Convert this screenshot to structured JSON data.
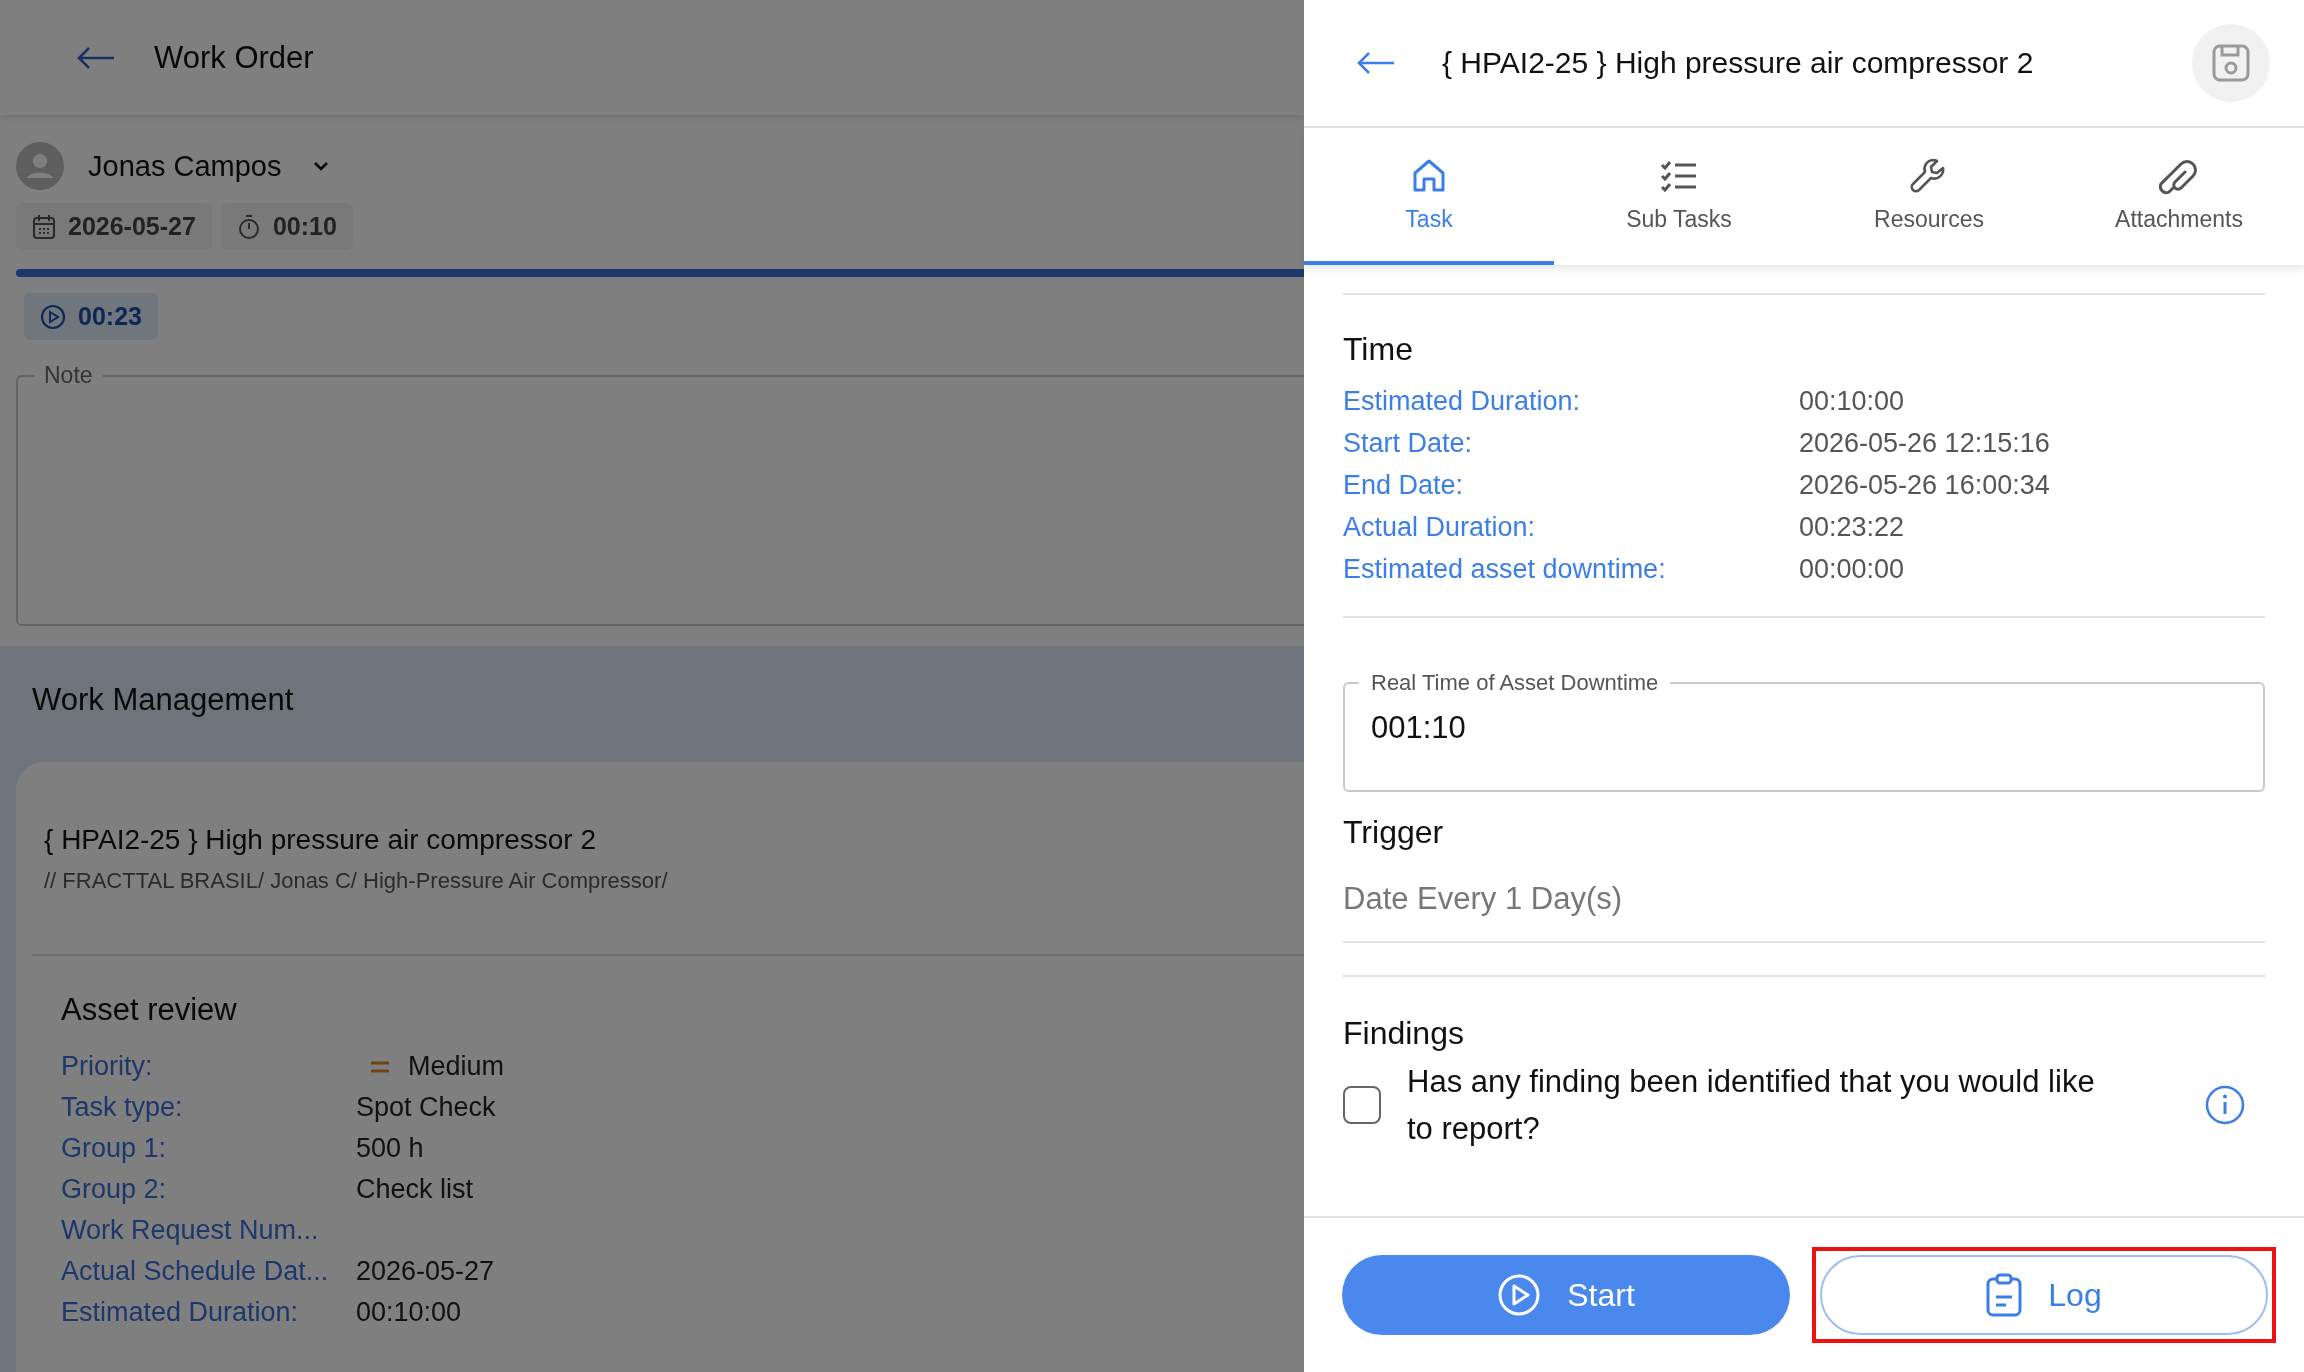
{
  "work_order": {
    "title": "Work Order",
    "assignee": "Jonas Campos",
    "date": "2026-05-27",
    "duration": "00:10",
    "progress": {
      "level": 1
    },
    "timer": "00:23",
    "note": {
      "label": "Note"
    }
  },
  "work_management": {
    "title": "Work Management",
    "asset_title": "{ HPAI2-25 } High pressure air compressor 2",
    "asset_path": "// FRACTTAL BRASIL/ Jonas C/ High-Pressure Air Compressor/",
    "section": "Asset review",
    "fields": [
      {
        "label": "Priority:",
        "value": "Medium",
        "kind": "priority"
      },
      {
        "label": "Task type:",
        "value": "Spot Check",
        "kind": "text"
      },
      {
        "label": "Group 1:",
        "value": "500 h",
        "kind": "text"
      },
      {
        "label": "Group 2:",
        "value": "Check list",
        "kind": "text"
      },
      {
        "label": "Work Request Num..."
      },
      {
        "label": "Actual Schedule Dat...",
        "value": "2026-05-27",
        "kind": "text"
      },
      {
        "label": "Estimated Duration:",
        "value": "00:10:00",
        "kind": "text"
      }
    ]
  },
  "task_panel": {
    "title": "{ HPAI2-25 } High pressure air compressor 2",
    "tabs": [
      {
        "label": "Task",
        "selected": true,
        "kind": "home"
      },
      {
        "label": "Sub Tasks",
        "selected": false,
        "kind": "checklist"
      },
      {
        "label": "Resources",
        "selected": false,
        "kind": "wrench"
      },
      {
        "label": "Attachments",
        "selected": false,
        "kind": "clip"
      }
    ],
    "time": {
      "title": "Time",
      "rows": [
        {
          "label": "Estimated Duration:",
          "value": "00:10:00"
        },
        {
          "label": "Start Date:",
          "value": "2026-05-26 12:15:16"
        },
        {
          "label": "End Date:",
          "value": "2026-05-26 16:00:34"
        },
        {
          "label": "Actual Duration:",
          "value": "00:23:22"
        },
        {
          "label": "Estimated asset downtime:",
          "value": "00:00:00"
        }
      ]
    },
    "downtime_field": {
      "label": "Real Time of Asset Downtime",
      "value": "001:10"
    },
    "trigger": {
      "title": "Trigger",
      "value": "Date Every 1 Day(s)"
    },
    "findings": {
      "title": "Findings",
      "question": "Has any finding been identified that you would like to report?",
      "checked": false
    },
    "buttons": [
      {
        "label": "Start",
        "kind": "start",
        "highlighted": false
      },
      {
        "label": "Log",
        "kind": "log",
        "highlighted": true
      }
    ]
  }
}
